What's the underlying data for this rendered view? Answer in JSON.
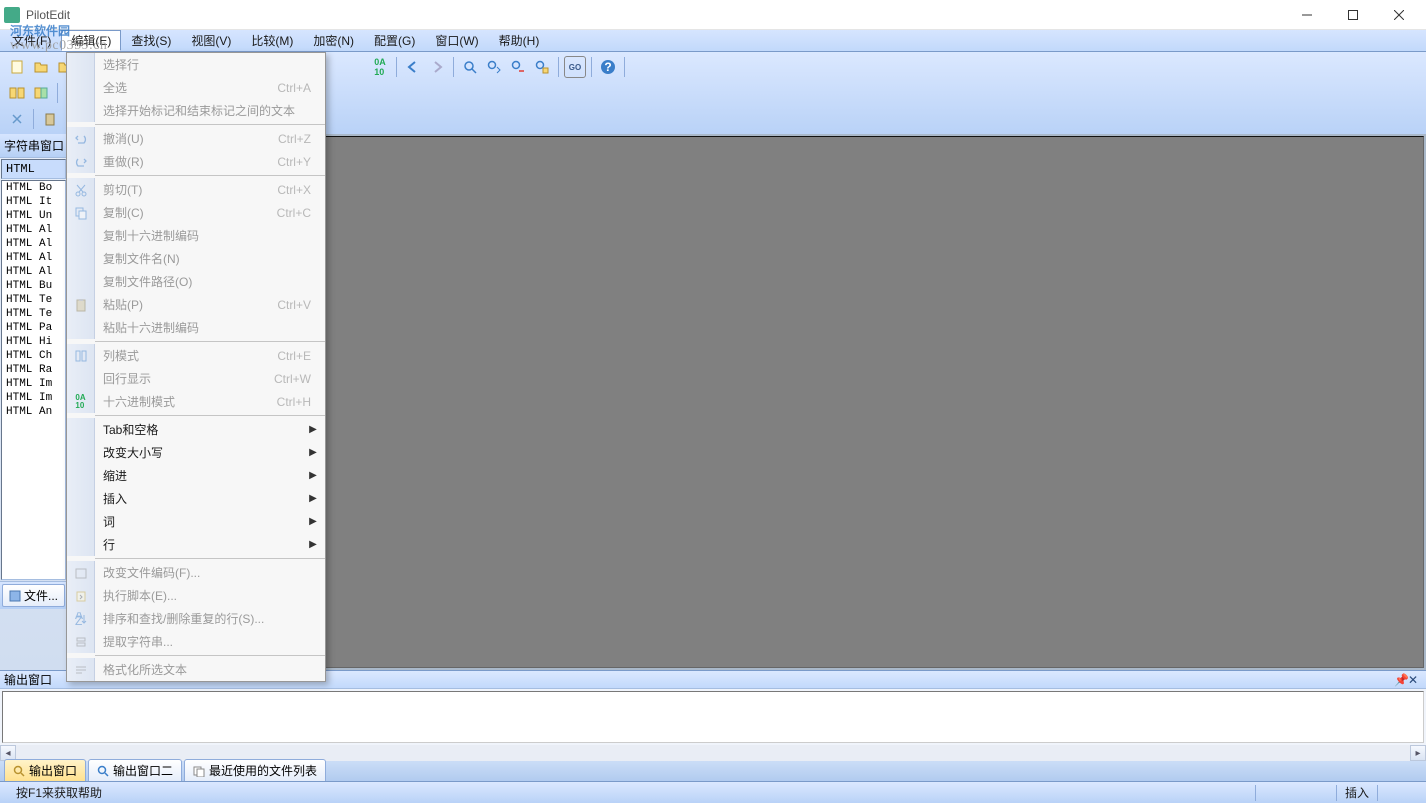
{
  "app": {
    "title": "PilotEdit"
  },
  "watermark": {
    "text": "河东软件园",
    "url": "www.pc0359.cn"
  },
  "menubar": {
    "file": "文件(F)",
    "edit": "编辑(E)",
    "search": "查找(S)",
    "view": "视图(V)",
    "compare": "比较(M)",
    "encrypt": "加密(N)",
    "config": "配置(G)",
    "window": "窗口(W)",
    "help": "帮助(H)"
  },
  "dropdown": {
    "select_line": "选择行",
    "select_all": {
      "label": "全选",
      "shortcut": "Ctrl+A"
    },
    "select_between_tags": "选择开始标记和结束标记之间的文本",
    "undo": {
      "label": "撤消(U)",
      "shortcut": "Ctrl+Z"
    },
    "redo": {
      "label": "重做(R)",
      "shortcut": "Ctrl+Y"
    },
    "cut": {
      "label": "剪切(T)",
      "shortcut": "Ctrl+X"
    },
    "copy": {
      "label": "复制(C)",
      "shortcut": "Ctrl+C"
    },
    "copy_hex": "复制十六进制编码",
    "copy_filename": "复制文件名(N)",
    "copy_filepath": "复制文件路径(O)",
    "paste": {
      "label": "粘贴(P)",
      "shortcut": "Ctrl+V"
    },
    "paste_hex": "粘贴十六进制编码",
    "column_mode": {
      "label": "列模式",
      "shortcut": "Ctrl+E"
    },
    "line_display": {
      "label": "回行显示",
      "shortcut": "Ctrl+W"
    },
    "hex_mode": {
      "label": "十六进制模式",
      "shortcut": "Ctrl+H"
    },
    "tab_space": "Tab和空格",
    "change_case": "改变大小写",
    "indent": "缩进",
    "insert": "插入",
    "word": "词",
    "line": "行",
    "change_encoding": "改变文件编码(F)...",
    "run_script": "执行脚本(E)...",
    "sort_find": "排序和查找/删除重复的行(S)...",
    "extract_string": "提取字符串...",
    "format_selected": "格式化所选文本"
  },
  "left_panel": {
    "header": "字符串窗口",
    "selected": "HTML",
    "items": [
      "HTML Bo",
      "HTML It",
      "HTML Un",
      "HTML Al",
      "HTML Al",
      "HTML Al",
      "HTML Al",
      "HTML Bu",
      "HTML Te",
      "HTML Te",
      "HTML Pa",
      "HTML Hi",
      "HTML Ch",
      "HTML Ra",
      "HTML Im",
      "HTML Im",
      "HTML An"
    ],
    "tab": "文件..."
  },
  "output": {
    "title": "输出窗口",
    "tab1": "输出窗口",
    "tab2": "输出窗口二",
    "tab3": "最近使用的文件列表"
  },
  "status": {
    "help": "按F1来获取帮助",
    "mode": "插入"
  }
}
